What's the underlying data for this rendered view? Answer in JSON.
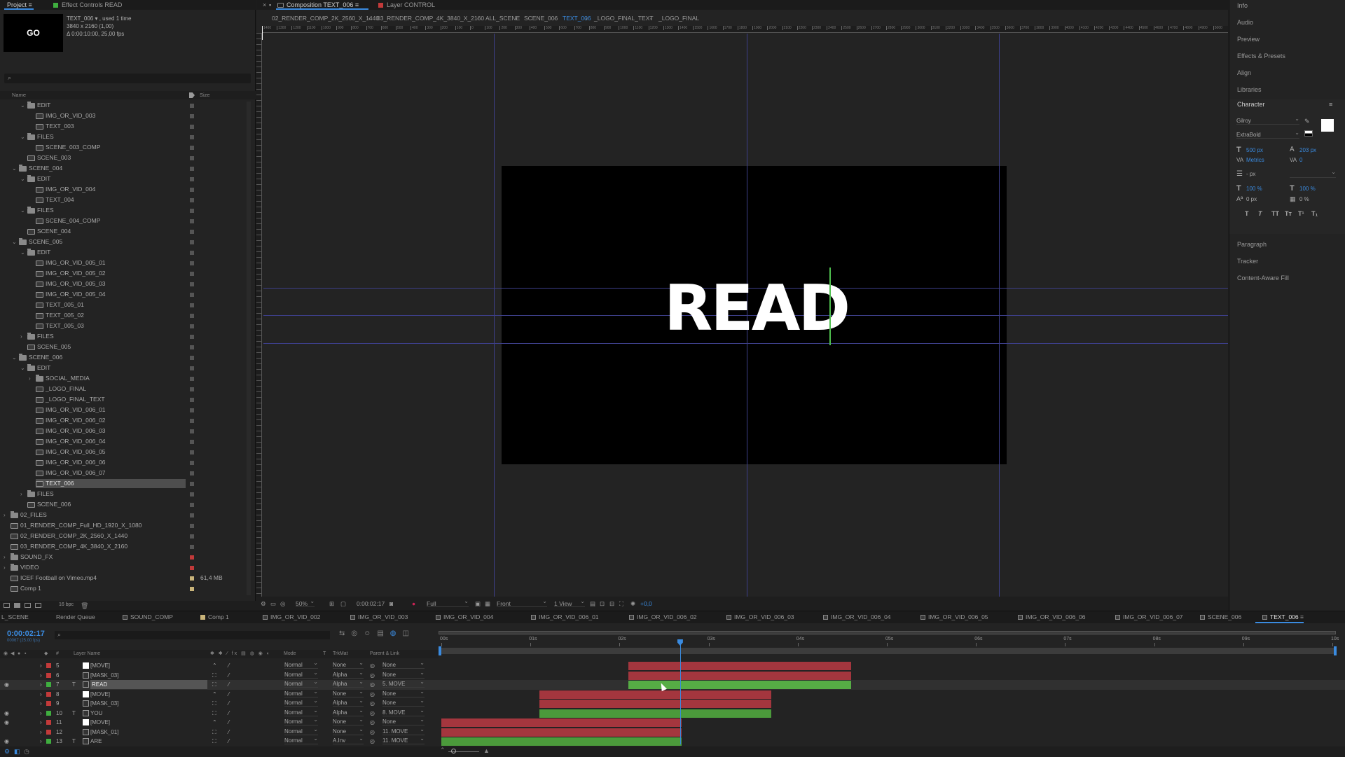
{
  "project_panel": {
    "tabs": [
      "Project",
      "Effect Controls READ"
    ],
    "thumb_text": "GO",
    "info_line1": "TEXT_006 ▾ , used 1 time",
    "info_line2": "3840 x 2160 (1,00)",
    "info_line3": "Δ 0:00:10:00, 25,00 fps",
    "search_placeholder": "",
    "col_name": "Name",
    "col_size": "Size",
    "bpc": "16 bpc",
    "tree": [
      {
        "label": "EDIT",
        "depth": 2,
        "type": "folder",
        "open": true
      },
      {
        "label": "IMG_OR_VID_003",
        "depth": 3,
        "type": "comp"
      },
      {
        "label": "TEXT_003",
        "depth": 3,
        "type": "comp"
      },
      {
        "label": "FILES",
        "depth": 2,
        "type": "folder",
        "open": true
      },
      {
        "label": "SCENE_003_COMP",
        "depth": 3,
        "type": "comp"
      },
      {
        "label": "SCENE_003",
        "depth": 2,
        "type": "comp"
      },
      {
        "label": "SCENE_004",
        "depth": 1,
        "type": "folder",
        "open": true
      },
      {
        "label": "EDIT",
        "depth": 2,
        "type": "folder",
        "open": true
      },
      {
        "label": "IMG_OR_VID_004",
        "depth": 3,
        "type": "comp"
      },
      {
        "label": "TEXT_004",
        "depth": 3,
        "type": "comp"
      },
      {
        "label": "FILES",
        "depth": 2,
        "type": "folder",
        "open": true
      },
      {
        "label": "SCENE_004_COMP",
        "depth": 3,
        "type": "comp"
      },
      {
        "label": "SCENE_004",
        "depth": 2,
        "type": "comp"
      },
      {
        "label": "SCENE_005",
        "depth": 1,
        "type": "folder",
        "open": true
      },
      {
        "label": "EDIT",
        "depth": 2,
        "type": "folder",
        "open": true
      },
      {
        "label": "IMG_OR_VID_005_01",
        "depth": 3,
        "type": "comp"
      },
      {
        "label": "IMG_OR_VID_005_02",
        "depth": 3,
        "type": "comp"
      },
      {
        "label": "IMG_OR_VID_005_03",
        "depth": 3,
        "type": "comp"
      },
      {
        "label": "IMG_OR_VID_005_04",
        "depth": 3,
        "type": "comp"
      },
      {
        "label": "TEXT_005_01",
        "depth": 3,
        "type": "comp"
      },
      {
        "label": "TEXT_005_02",
        "depth": 3,
        "type": "comp"
      },
      {
        "label": "TEXT_005_03",
        "depth": 3,
        "type": "comp"
      },
      {
        "label": "FILES",
        "depth": 2,
        "type": "folder",
        "open": false
      },
      {
        "label": "SCENE_005",
        "depth": 2,
        "type": "comp"
      },
      {
        "label": "SCENE_006",
        "depth": 1,
        "type": "folder",
        "open": true
      },
      {
        "label": "EDIT",
        "depth": 2,
        "type": "folder",
        "open": true
      },
      {
        "label": "SOCIAL_MEDIA",
        "depth": 3,
        "type": "folder",
        "open": false
      },
      {
        "label": "_LOGO_FINAL",
        "depth": 3,
        "type": "comp"
      },
      {
        "label": "_LOGO_FINAL_TEXT",
        "depth": 3,
        "type": "comp"
      },
      {
        "label": "IMG_OR_VID_006_01",
        "depth": 3,
        "type": "comp"
      },
      {
        "label": "IMG_OR_VID_006_02",
        "depth": 3,
        "type": "comp"
      },
      {
        "label": "IMG_OR_VID_006_03",
        "depth": 3,
        "type": "comp"
      },
      {
        "label": "IMG_OR_VID_006_04",
        "depth": 3,
        "type": "comp"
      },
      {
        "label": "IMG_OR_VID_006_05",
        "depth": 3,
        "type": "comp"
      },
      {
        "label": "IMG_OR_VID_006_06",
        "depth": 3,
        "type": "comp"
      },
      {
        "label": "IMG_OR_VID_006_07",
        "depth": 3,
        "type": "comp"
      },
      {
        "label": "TEXT_006",
        "depth": 3,
        "type": "comp",
        "selected": true
      },
      {
        "label": "FILES",
        "depth": 2,
        "type": "folder",
        "open": false
      },
      {
        "label": "SCENE_006",
        "depth": 2,
        "type": "comp"
      },
      {
        "label": "02_FILES",
        "depth": 0,
        "type": "folder",
        "open": false
      },
      {
        "label": "01_RENDER_COMP_Full_HD_1920_X_1080",
        "depth": 0,
        "type": "comp"
      },
      {
        "label": "02_RENDER_COMP_2K_2560_X_1440",
        "depth": 0,
        "type": "comp"
      },
      {
        "label": "03_RENDER_COMP_4K_3840_X_2160",
        "depth": 0,
        "type": "comp"
      },
      {
        "label": "SOUND_FX",
        "depth": 0,
        "type": "folder",
        "open": false,
        "swatch": "#c23a3a"
      },
      {
        "label": "VIDEO",
        "depth": 0,
        "type": "folder",
        "open": false,
        "swatch": "#c23a3a"
      },
      {
        "label": "ICEF Football on Vimeo.mp4",
        "depth": 0,
        "type": "file",
        "size": "61,4 MB",
        "swatch": "#c9b47a"
      },
      {
        "label": "Comp 1",
        "depth": 0,
        "type": "comp",
        "swatch": "#c9b47a"
      }
    ]
  },
  "comp_panel": {
    "tab_comp": "Composition TEXT_006",
    "tab_layer": "Layer CONTROL",
    "breadcrumbs": [
      "02_RENDER_COMP_2K_2560_X_1440",
      "03_RENDER_COMP_4K_3840_X_2160",
      "ALL_SCENE",
      "SCENE_006",
      "TEXT_006",
      "_LOGO_FINAL_TEXT",
      "_LOGO_FINAL"
    ],
    "canvas_text": "READ",
    "ruler_labels": [
      "1400",
      "1300",
      "1200",
      "1100",
      "1000",
      "900",
      "800",
      "700",
      "600",
      "500",
      "400",
      "300",
      "200",
      "100",
      "0",
      "100",
      "200",
      "300",
      "400",
      "500",
      "600",
      "700",
      "800",
      "900",
      "1000",
      "1100",
      "1200",
      "1300",
      "1400",
      "1500",
      "1600",
      "1700",
      "1800",
      "1900",
      "2000",
      "2100",
      "2200",
      "2300",
      "2400",
      "2500",
      "2600",
      "2700",
      "2800",
      "2900",
      "3000",
      "3100",
      "3200",
      "3300",
      "3400",
      "3500",
      "3600",
      "3700",
      "3800",
      "3900",
      "4000",
      "4100",
      "4200",
      "4300",
      "4400",
      "4500",
      "4600",
      "4700",
      "4800",
      "4900",
      "5000"
    ],
    "zoom": "50%",
    "timecode": "0:00:02:17",
    "resolution": "Full",
    "view": "Front",
    "views": "1 View",
    "exposure": "+0,0"
  },
  "right_panel": {
    "items": [
      "Info",
      "Audio",
      "Preview",
      "Effects & Presets",
      "Align",
      "Libraries"
    ],
    "character_title": "Character",
    "font_family": "Gilroy",
    "font_style": "ExtraBold",
    "font_size": "500 px",
    "leading": "203 px",
    "kerning": "Metrics",
    "tracking": "0",
    "stroke_unit": "- px",
    "vscale": "100 %",
    "hscale": "100 %",
    "baseline": "0 px",
    "tsume": "0 %",
    "style_buttons": [
      "T",
      "T",
      "TT",
      "Tт",
      "T¹",
      "T₁"
    ],
    "bottom_items": [
      "Paragraph",
      "Tracker",
      "Content-Aware Fill"
    ]
  },
  "timeline": {
    "tabs": [
      {
        "label": "L_SCENE",
        "color": ""
      },
      {
        "label": "Render Queue",
        "color": ""
      },
      {
        "label": "SOUND_COMP",
        "color": "#3a3a3a"
      },
      {
        "label": "Comp 1",
        "color": "#c9b47a"
      },
      {
        "label": "IMG_OR_VID_002",
        "color": "#3a3a3a"
      },
      {
        "label": "IMG_OR_VID_003",
        "color": "#3a3a3a"
      },
      {
        "label": "IMG_OR_VID_004",
        "color": "#3a3a3a"
      },
      {
        "label": "IMG_OR_VID_006_01",
        "color": "#3a3a3a"
      },
      {
        "label": "IMG_OR_VID_006_02",
        "color": "#3a3a3a"
      },
      {
        "label": "IMG_OR_VID_006_03",
        "color": "#3a3a3a"
      },
      {
        "label": "IMG_OR_VID_006_04",
        "color": "#3a3a3a"
      },
      {
        "label": "IMG_OR_VID_006_05",
        "color": "#3a3a3a"
      },
      {
        "label": "IMG_OR_VID_006_06",
        "color": "#3a3a3a"
      },
      {
        "label": "IMG_OR_VID_006_07",
        "color": "#3a3a3a"
      },
      {
        "label": "SCENE_006",
        "color": "#3a3a3a"
      },
      {
        "label": "TEXT_006",
        "color": "#3a3a3a",
        "active": true
      }
    ],
    "timecode": "0:00:02:17",
    "frame_info": "00067 (25.00 fps)",
    "headers": {
      "layer_name": "Layer Name",
      "mode": "Mode",
      "t": "T",
      "trkmat": "TrkMat",
      "parent": "Parent & Link"
    },
    "ruler": [
      "00s",
      "01s",
      "02s",
      "03s",
      "04s",
      "05s",
      "06s",
      "07s",
      "08s",
      "09s",
      "10s"
    ],
    "layers": [
      {
        "num": "5",
        "name": "[MOVE]",
        "type": "null",
        "color": "#c23a3a",
        "mode": "Normal",
        "trkmat": "None",
        "parent": "None",
        "bar_start": 2.1,
        "bar_end": 4.6,
        "bar_color": "#a4363e",
        "eye": false
      },
      {
        "num": "6",
        "name": "[MASK_03]",
        "type": "comp",
        "color": "#c23a3a",
        "mode": "Normal",
        "trkmat": "Alpha",
        "parent": "None",
        "bar_start": 2.1,
        "bar_end": 4.6,
        "bar_color": "#a4363e",
        "eye": false
      },
      {
        "num": "7",
        "name": "READ",
        "type": "text",
        "color": "#3fae3f",
        "mode": "Normal",
        "trkmat": "Alpha",
        "parent": "5. MOVE",
        "bar_start": 2.1,
        "bar_end": 4.6,
        "bar_color": "#4b9a3b",
        "eye": true,
        "selected": true
      },
      {
        "num": "8",
        "name": "[MOVE]",
        "type": "null",
        "color": "#c23a3a",
        "mode": "Normal",
        "trkmat": "None",
        "parent": "None",
        "bar_start": 1.1,
        "bar_end": 3.7,
        "bar_color": "#a4363e",
        "eye": false
      },
      {
        "num": "9",
        "name": "[MASK_03]",
        "type": "comp",
        "color": "#c23a3a",
        "mode": "Normal",
        "trkmat": "Alpha",
        "parent": "None",
        "bar_start": 1.1,
        "bar_end": 3.7,
        "bar_color": "#a4363e",
        "eye": false
      },
      {
        "num": "10",
        "name": "YOU",
        "type": "text",
        "color": "#3fae3f",
        "mode": "Normal",
        "trkmat": "Alpha",
        "parent": "8. MOVE",
        "bar_start": 1.1,
        "bar_end": 3.7,
        "bar_color": "#4b9a3b",
        "eye": true
      },
      {
        "num": "11",
        "name": "[MOVE]",
        "type": "null",
        "color": "#c23a3a",
        "mode": "Normal",
        "trkmat": "None",
        "parent": "None",
        "bar_start": 0.0,
        "bar_end": 2.7,
        "bar_color": "#a4363e",
        "eye": true
      },
      {
        "num": "12",
        "name": "[MASK_01]",
        "type": "comp",
        "color": "#c23a3a",
        "mode": "Normal",
        "trkmat": "None",
        "parent": "11. MOVE",
        "bar_start": 0.0,
        "bar_end": 2.7,
        "bar_color": "#a4363e",
        "eye": false
      },
      {
        "num": "13",
        "name": "ARE",
        "type": "text",
        "color": "#3fae3f",
        "mode": "Normal",
        "trkmat": "A.Inv",
        "parent": "11. MOVE",
        "bar_start": 0.0,
        "bar_end": 2.7,
        "bar_color": "#4b9a3b",
        "eye": true
      }
    ],
    "playhead_seconds": 2.68,
    "colors": {
      "accent": "#3a8be0",
      "red_bar": "#a4363e",
      "green_bar": "#4b9a3b"
    }
  }
}
